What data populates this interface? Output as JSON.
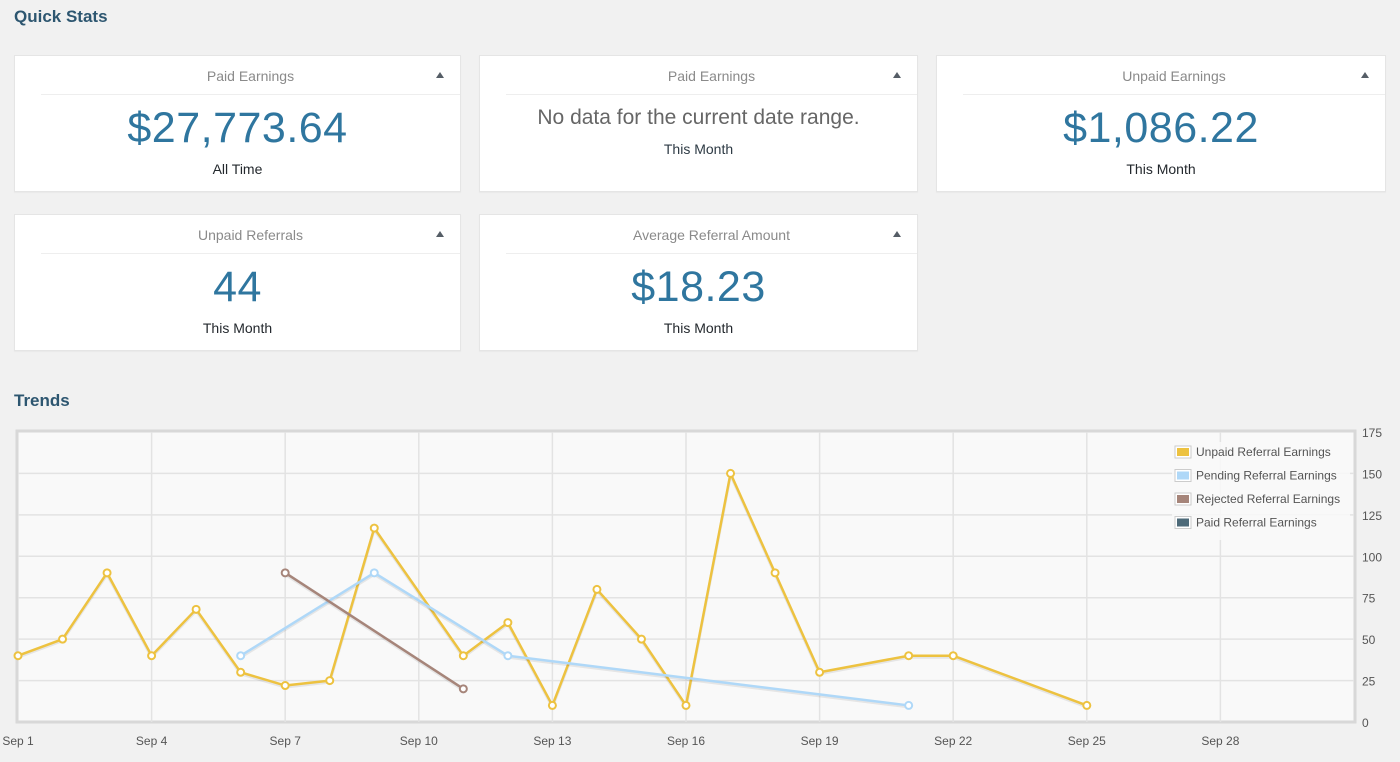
{
  "quick_stats": {
    "title": "Quick Stats",
    "cards": [
      {
        "title": "Paid Earnings",
        "value": "$27,773.64",
        "period": "All Time"
      },
      {
        "title": "Paid Earnings",
        "no_data": "No data for the current date range.",
        "period": "This Month"
      },
      {
        "title": "Unpaid Earnings",
        "value": "$1,086.22",
        "period": "This Month"
      },
      {
        "title": "Unpaid Referrals",
        "value": "44",
        "period": "This Month"
      },
      {
        "title": "Average Referral Amount",
        "value": "$18.23",
        "period": "This Month"
      }
    ],
    "toggle_icon": "triangle-up-icon"
  },
  "trends": {
    "title": "Trends"
  },
  "chart_data": {
    "type": "line",
    "title": "",
    "xlabel": "",
    "ylabel": "",
    "x_range": [
      1,
      31
    ],
    "ylim": [
      0,
      175
    ],
    "y_ticks": [
      0,
      25,
      50,
      75,
      100,
      125,
      150,
      175
    ],
    "x_ticks": [
      {
        "day": 1,
        "label": "Sep 1"
      },
      {
        "day": 4,
        "label": "Sep 4"
      },
      {
        "day": 7,
        "label": "Sep 7"
      },
      {
        "day": 10,
        "label": "Sep 10"
      },
      {
        "day": 13,
        "label": "Sep 13"
      },
      {
        "day": 16,
        "label": "Sep 16"
      },
      {
        "day": 19,
        "label": "Sep 19"
      },
      {
        "day": 22,
        "label": "Sep 22"
      },
      {
        "day": 25,
        "label": "Sep 25"
      },
      {
        "day": 28,
        "label": "Sep 28"
      }
    ],
    "y_axis_side": "right",
    "grid": true,
    "legend_position": "top-right",
    "series": [
      {
        "name": "Unpaid Referral Earnings",
        "color": "#edc240",
        "points": [
          [
            1,
            40
          ],
          [
            2,
            50
          ],
          [
            3,
            90
          ],
          [
            4,
            40
          ],
          [
            5,
            68
          ],
          [
            6,
            30
          ],
          [
            7,
            22
          ],
          [
            8,
            25
          ],
          [
            9,
            117
          ],
          [
            11,
            40
          ],
          [
            12,
            60
          ],
          [
            13,
            10
          ],
          [
            14,
            80
          ],
          [
            15,
            50
          ],
          [
            16,
            10
          ],
          [
            17,
            150
          ],
          [
            18,
            90
          ],
          [
            19,
            30
          ],
          [
            21,
            40
          ],
          [
            22,
            40
          ],
          [
            25,
            10
          ]
        ]
      },
      {
        "name": "Pending Referral Earnings",
        "color": "#afd8f8",
        "points": [
          [
            6,
            40
          ],
          [
            9,
            90
          ],
          [
            12,
            40
          ],
          [
            21,
            10
          ]
        ]
      },
      {
        "name": "Rejected Referral Earnings",
        "color": "#a6857a",
        "points": [
          [
            7,
            90
          ],
          [
            11,
            20
          ]
        ]
      },
      {
        "name": "Paid Referral Earnings",
        "color": "#4d6a79",
        "points": []
      }
    ]
  }
}
